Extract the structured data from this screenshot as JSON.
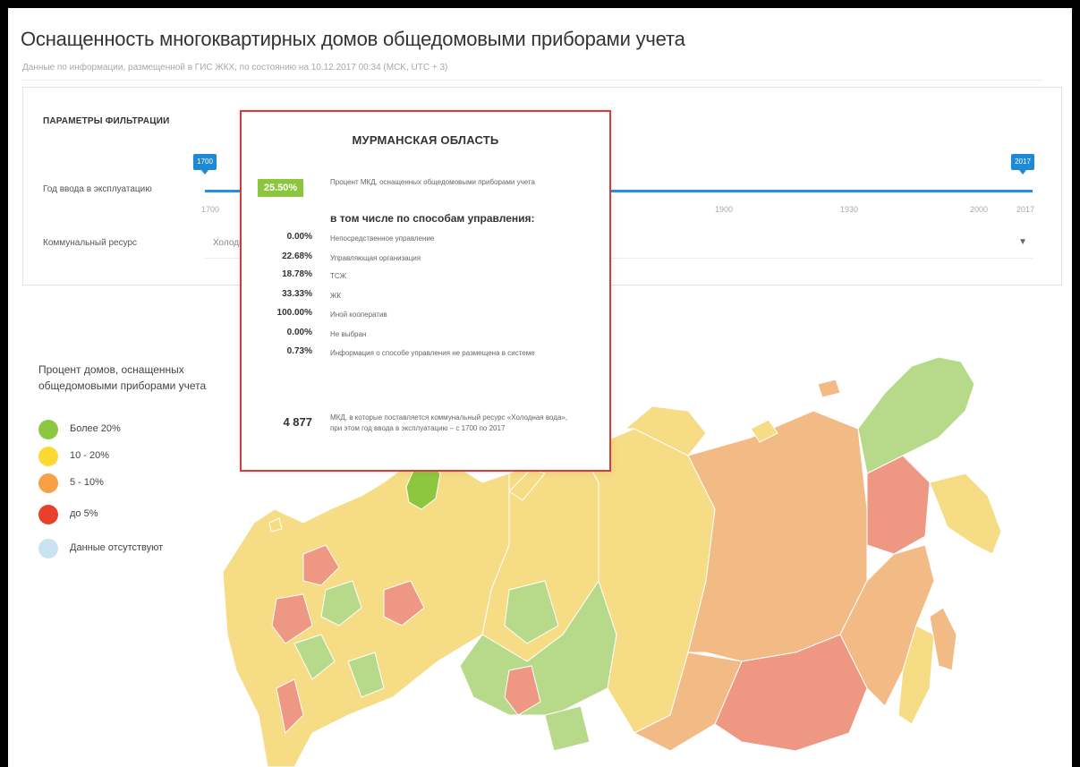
{
  "header": {
    "title": "Оснащенность многоквартирных домов общедомовыми приборами учета",
    "subtitle": "Данные по информации, размещенной в ГИС ЖКХ, по состоянию на 10.12.2017 00:34 (MCK, UTC + 3)"
  },
  "filters": {
    "title": "ПАРАМЕТРЫ ФИЛЬТРАЦИИ",
    "year_label": "Год ввода в эксплуатацию",
    "year_from": "1700",
    "year_to": "2017",
    "ticks": [
      "1700",
      "1900",
      "1930",
      "2000",
      "2017"
    ],
    "resource_label": "Коммунальный ресурс",
    "resource_value": "Холодная вода"
  },
  "tooltip": {
    "region": "МУРМАНСКАЯ ОБЛАСТЬ",
    "percent": "25.50%",
    "percent_desc": "Процент МКД, оснащенных общедомовыми приборами учета",
    "subheading": "в том числе по способам управления:",
    "rows": [
      {
        "value": "0.00%",
        "label": "Непосредственное управление"
      },
      {
        "value": "22.68%",
        "label": "Управляющая организация"
      },
      {
        "value": "18.78%",
        "label": "ТСЖ"
      },
      {
        "value": "33.33%",
        "label": "ЖК"
      },
      {
        "value": "100.00%",
        "label": "Иной кооператив"
      },
      {
        "value": "0.00%",
        "label": "Не выбран"
      },
      {
        "value": "0.73%",
        "label": "Информация о способе управления не размещена в системе"
      }
    ],
    "count": "4 877",
    "count_desc": "МКД, в которые поставляется коммунальный ресурс «Холодная вода», при этом год ввода в эксплуатацию – с 1700 по 2017"
  },
  "legend": {
    "title": "Процент домов, оснащенных общедомовыми приборами учета",
    "items": [
      {
        "label": "Более 20%",
        "color": "#8dc63f"
      },
      {
        "label": "10 - 20%",
        "color": "#fdd832"
      },
      {
        "label": "5 - 10%",
        "color": "#f7a045"
      },
      {
        "label": "до 5%",
        "color": "#e8402a"
      },
      {
        "label": "Данные отсутствуют",
        "color": "#c8e3f1"
      }
    ]
  },
  "map_colors": {
    "green": "#b7d98a",
    "yellow": "#f5dc85",
    "orange": "#f2bb86",
    "red": "#ee9883",
    "murmansk": "#8dc63f"
  }
}
